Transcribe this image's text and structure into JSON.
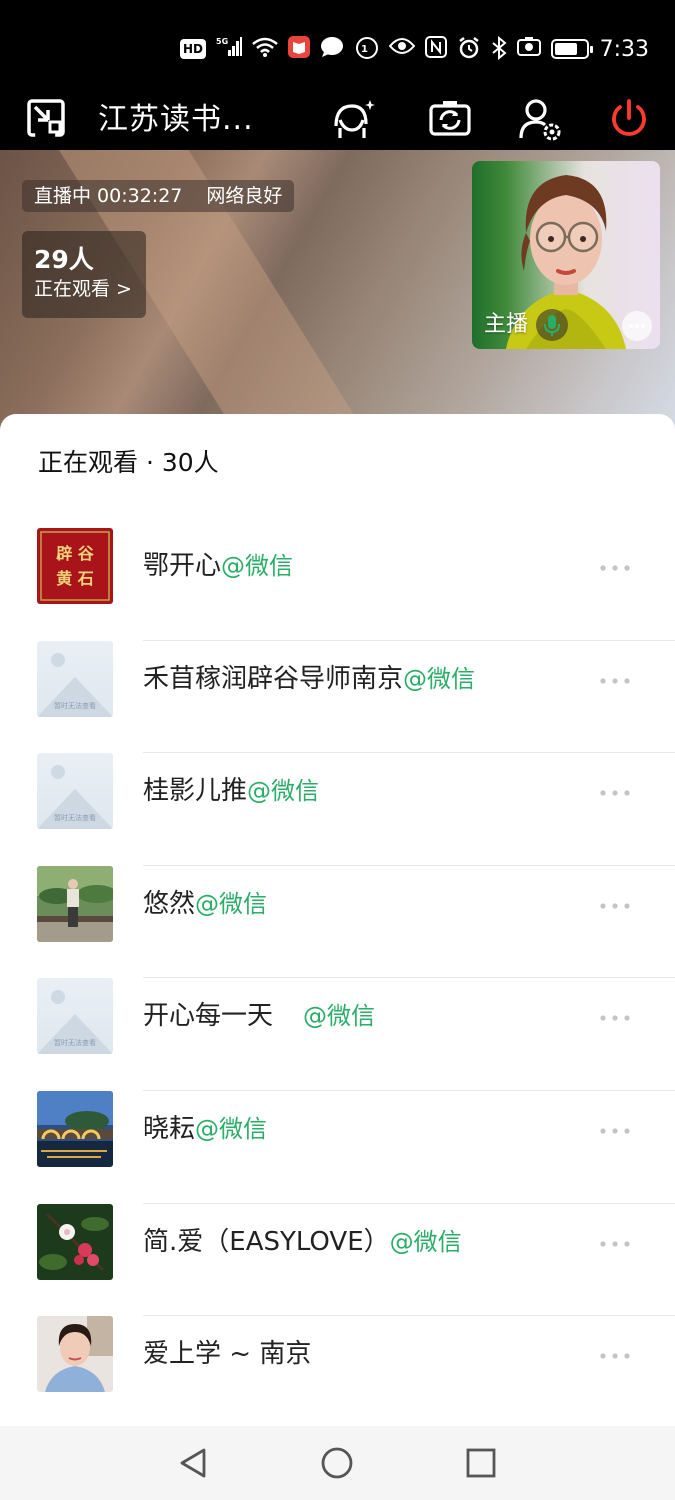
{
  "status_bar": {
    "hd": "HD",
    "network": "5G",
    "time": "7:33",
    "icons": [
      "signal-icon",
      "wifi-icon",
      "book-app-icon",
      "message-icon",
      "data-saver-icon",
      "eye-icon",
      "nfc-icon",
      "alarm-icon",
      "bluetooth-icon",
      "camera-icon",
      "battery-icon"
    ]
  },
  "toolbar": {
    "title": "江苏读书...",
    "icons": [
      "minimize-window-icon",
      "beauty-filter-icon",
      "flip-camera-icon",
      "user-settings-icon",
      "power-icon"
    ],
    "power_color": "#ff3b30"
  },
  "live": {
    "status": "直播中 00:32:27",
    "network": "网络良好",
    "viewer_count": "29人",
    "viewer_label": "正在观看 >"
  },
  "host": {
    "label": "主播",
    "mic_color": "#2aae67"
  },
  "sheet": {
    "title": "正在观看 · 30人"
  },
  "viewers": [
    {
      "name": "鄂开心",
      "source": "@微信",
      "avatar": "red-book-avatar",
      "avatar_text": "辟谷 黄石"
    },
    {
      "name": "禾苜稼润辟谷导师南京",
      "source": "@微信",
      "avatar": "placeholder-avatar",
      "avatar_text": "暂时无法查看"
    },
    {
      "name": "桂影儿推",
      "source": "@微信",
      "avatar": "placeholder-avatar",
      "avatar_text": "暂时无法查看"
    },
    {
      "name": "悠然",
      "source": "@微信",
      "avatar": "photo-avatar"
    },
    {
      "name": "开心每一天",
      "source": "@微信",
      "avatar": "placeholder-avatar",
      "avatar_text": "暂时无法查看"
    },
    {
      "name": "晓耘",
      "source": "@微信",
      "avatar": "night-bridge-avatar"
    },
    {
      "name": "简.爱（EASYLOVE）",
      "source": "@微信",
      "avatar": "flower-avatar"
    },
    {
      "name": "爱上学 ~ 南京",
      "source": "",
      "avatar": "selfie-avatar"
    }
  ],
  "colors": {
    "accent_green": "#2aae67",
    "text_primary": "#222222",
    "divider": "#e8e8e8"
  },
  "nav_bar": {
    "icons": [
      "back-triangle-icon",
      "home-circle-icon",
      "recents-square-icon"
    ]
  }
}
